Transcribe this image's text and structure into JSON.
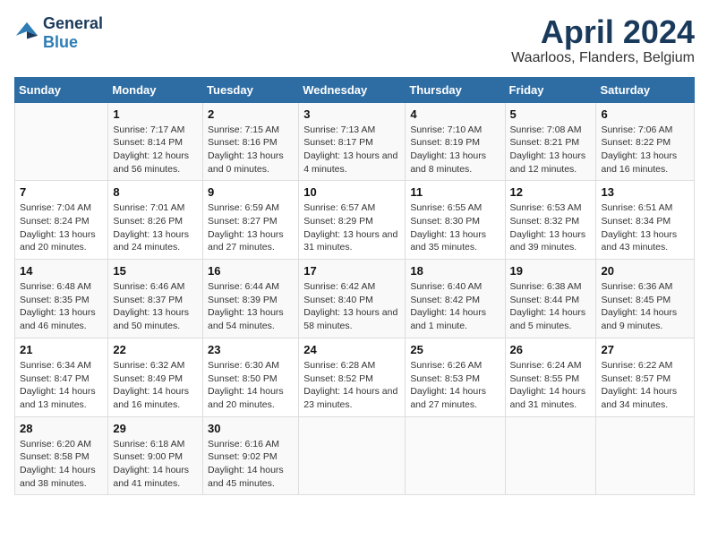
{
  "logo": {
    "line1": "General",
    "line2": "Blue"
  },
  "title": "April 2024",
  "location": "Waarloos, Flanders, Belgium",
  "weekdays": [
    "Sunday",
    "Monday",
    "Tuesday",
    "Wednesday",
    "Thursday",
    "Friday",
    "Saturday"
  ],
  "weeks": [
    [
      {
        "day": "",
        "sunrise": "",
        "sunset": "",
        "daylight": ""
      },
      {
        "day": "1",
        "sunrise": "Sunrise: 7:17 AM",
        "sunset": "Sunset: 8:14 PM",
        "daylight": "Daylight: 12 hours and 56 minutes."
      },
      {
        "day": "2",
        "sunrise": "Sunrise: 7:15 AM",
        "sunset": "Sunset: 8:16 PM",
        "daylight": "Daylight: 13 hours and 0 minutes."
      },
      {
        "day": "3",
        "sunrise": "Sunrise: 7:13 AM",
        "sunset": "Sunset: 8:17 PM",
        "daylight": "Daylight: 13 hours and 4 minutes."
      },
      {
        "day": "4",
        "sunrise": "Sunrise: 7:10 AM",
        "sunset": "Sunset: 8:19 PM",
        "daylight": "Daylight: 13 hours and 8 minutes."
      },
      {
        "day": "5",
        "sunrise": "Sunrise: 7:08 AM",
        "sunset": "Sunset: 8:21 PM",
        "daylight": "Daylight: 13 hours and 12 minutes."
      },
      {
        "day": "6",
        "sunrise": "Sunrise: 7:06 AM",
        "sunset": "Sunset: 8:22 PM",
        "daylight": "Daylight: 13 hours and 16 minutes."
      }
    ],
    [
      {
        "day": "7",
        "sunrise": "Sunrise: 7:04 AM",
        "sunset": "Sunset: 8:24 PM",
        "daylight": "Daylight: 13 hours and 20 minutes."
      },
      {
        "day": "8",
        "sunrise": "Sunrise: 7:01 AM",
        "sunset": "Sunset: 8:26 PM",
        "daylight": "Daylight: 13 hours and 24 minutes."
      },
      {
        "day": "9",
        "sunrise": "Sunrise: 6:59 AM",
        "sunset": "Sunset: 8:27 PM",
        "daylight": "Daylight: 13 hours and 27 minutes."
      },
      {
        "day": "10",
        "sunrise": "Sunrise: 6:57 AM",
        "sunset": "Sunset: 8:29 PM",
        "daylight": "Daylight: 13 hours and 31 minutes."
      },
      {
        "day": "11",
        "sunrise": "Sunrise: 6:55 AM",
        "sunset": "Sunset: 8:30 PM",
        "daylight": "Daylight: 13 hours and 35 minutes."
      },
      {
        "day": "12",
        "sunrise": "Sunrise: 6:53 AM",
        "sunset": "Sunset: 8:32 PM",
        "daylight": "Daylight: 13 hours and 39 minutes."
      },
      {
        "day": "13",
        "sunrise": "Sunrise: 6:51 AM",
        "sunset": "Sunset: 8:34 PM",
        "daylight": "Daylight: 13 hours and 43 minutes."
      }
    ],
    [
      {
        "day": "14",
        "sunrise": "Sunrise: 6:48 AM",
        "sunset": "Sunset: 8:35 PM",
        "daylight": "Daylight: 13 hours and 46 minutes."
      },
      {
        "day": "15",
        "sunrise": "Sunrise: 6:46 AM",
        "sunset": "Sunset: 8:37 PM",
        "daylight": "Daylight: 13 hours and 50 minutes."
      },
      {
        "day": "16",
        "sunrise": "Sunrise: 6:44 AM",
        "sunset": "Sunset: 8:39 PM",
        "daylight": "Daylight: 13 hours and 54 minutes."
      },
      {
        "day": "17",
        "sunrise": "Sunrise: 6:42 AM",
        "sunset": "Sunset: 8:40 PM",
        "daylight": "Daylight: 13 hours and 58 minutes."
      },
      {
        "day": "18",
        "sunrise": "Sunrise: 6:40 AM",
        "sunset": "Sunset: 8:42 PM",
        "daylight": "Daylight: 14 hours and 1 minute."
      },
      {
        "day": "19",
        "sunrise": "Sunrise: 6:38 AM",
        "sunset": "Sunset: 8:44 PM",
        "daylight": "Daylight: 14 hours and 5 minutes."
      },
      {
        "day": "20",
        "sunrise": "Sunrise: 6:36 AM",
        "sunset": "Sunset: 8:45 PM",
        "daylight": "Daylight: 14 hours and 9 minutes."
      }
    ],
    [
      {
        "day": "21",
        "sunrise": "Sunrise: 6:34 AM",
        "sunset": "Sunset: 8:47 PM",
        "daylight": "Daylight: 14 hours and 13 minutes."
      },
      {
        "day": "22",
        "sunrise": "Sunrise: 6:32 AM",
        "sunset": "Sunset: 8:49 PM",
        "daylight": "Daylight: 14 hours and 16 minutes."
      },
      {
        "day": "23",
        "sunrise": "Sunrise: 6:30 AM",
        "sunset": "Sunset: 8:50 PM",
        "daylight": "Daylight: 14 hours and 20 minutes."
      },
      {
        "day": "24",
        "sunrise": "Sunrise: 6:28 AM",
        "sunset": "Sunset: 8:52 PM",
        "daylight": "Daylight: 14 hours and 23 minutes."
      },
      {
        "day": "25",
        "sunrise": "Sunrise: 6:26 AM",
        "sunset": "Sunset: 8:53 PM",
        "daylight": "Daylight: 14 hours and 27 minutes."
      },
      {
        "day": "26",
        "sunrise": "Sunrise: 6:24 AM",
        "sunset": "Sunset: 8:55 PM",
        "daylight": "Daylight: 14 hours and 31 minutes."
      },
      {
        "day": "27",
        "sunrise": "Sunrise: 6:22 AM",
        "sunset": "Sunset: 8:57 PM",
        "daylight": "Daylight: 14 hours and 34 minutes."
      }
    ],
    [
      {
        "day": "28",
        "sunrise": "Sunrise: 6:20 AM",
        "sunset": "Sunset: 8:58 PM",
        "daylight": "Daylight: 14 hours and 38 minutes."
      },
      {
        "day": "29",
        "sunrise": "Sunrise: 6:18 AM",
        "sunset": "Sunset: 9:00 PM",
        "daylight": "Daylight: 14 hours and 41 minutes."
      },
      {
        "day": "30",
        "sunrise": "Sunrise: 6:16 AM",
        "sunset": "Sunset: 9:02 PM",
        "daylight": "Daylight: 14 hours and 45 minutes."
      },
      {
        "day": "",
        "sunrise": "",
        "sunset": "",
        "daylight": ""
      },
      {
        "day": "",
        "sunrise": "",
        "sunset": "",
        "daylight": ""
      },
      {
        "day": "",
        "sunrise": "",
        "sunset": "",
        "daylight": ""
      },
      {
        "day": "",
        "sunrise": "",
        "sunset": "",
        "daylight": ""
      }
    ]
  ]
}
